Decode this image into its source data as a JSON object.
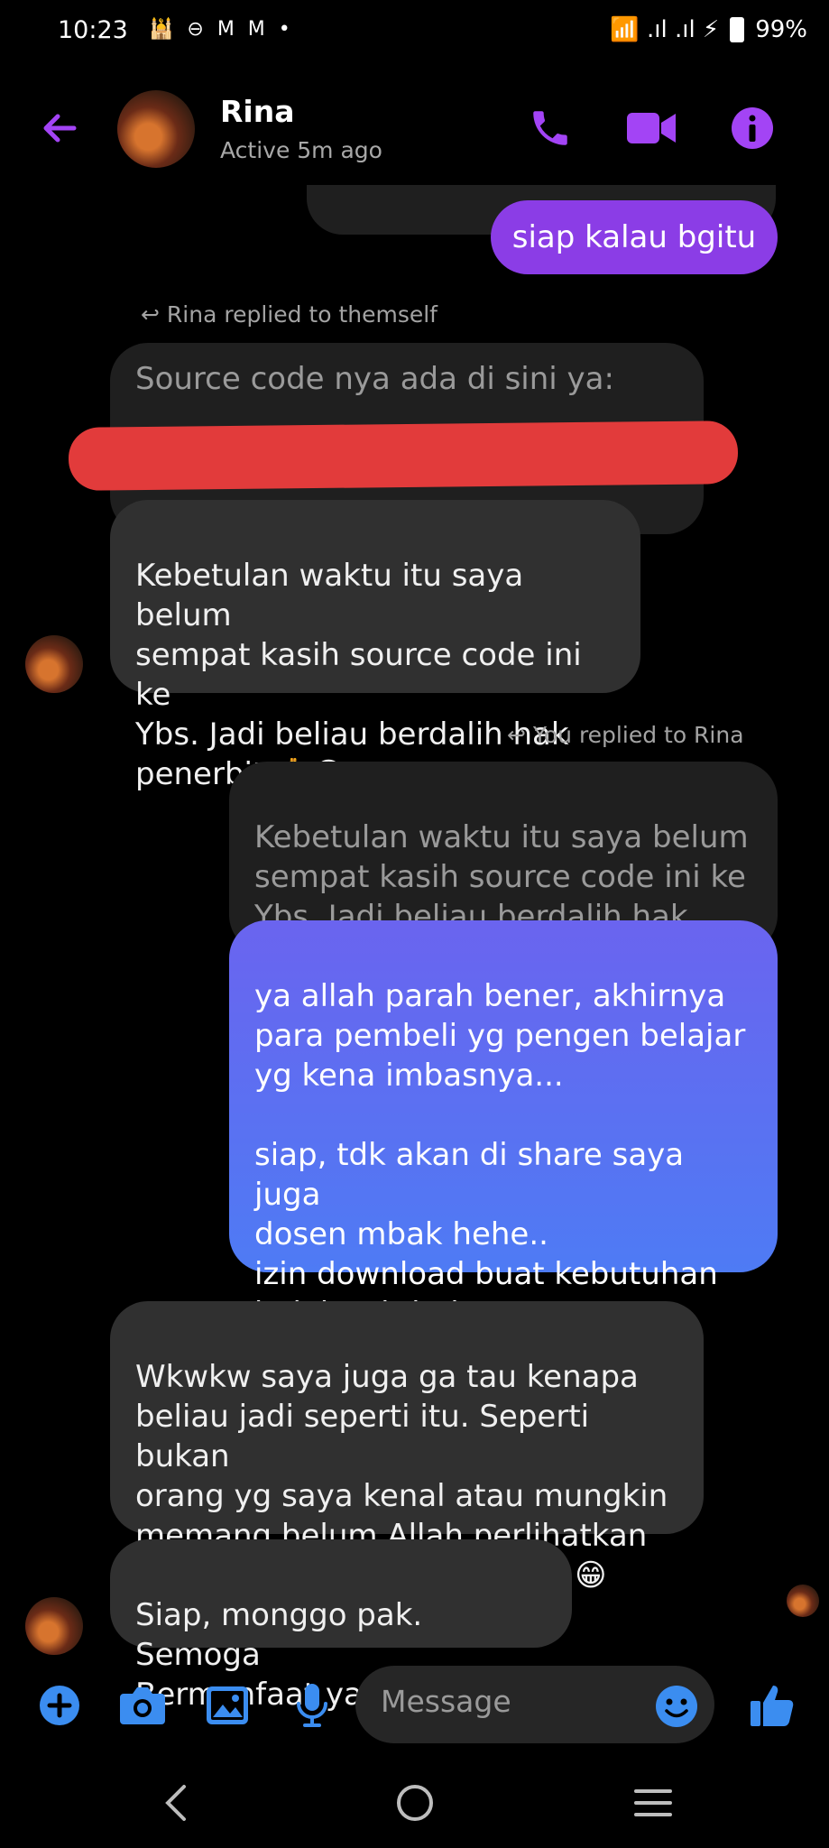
{
  "status_bar": {
    "time": "10:23",
    "left_icons": "🕌 ⊖ M M •",
    "right_icons": "📶 .ıl .ıl ⚡",
    "battery": "99%"
  },
  "header": {
    "name": "Rina",
    "status": "Active 5m ago",
    "icons": [
      "back-arrow-icon",
      "phone-icon",
      "video-icon",
      "info-icon"
    ],
    "accent_color": "#a344f5"
  },
  "messages": {
    "m1_out": "siap kalau bgitu",
    "note1": "Rina replied to themself",
    "m2_quoted": "Source code nya ada di sini ya:",
    "m3_in": "Kebetulan waktu itu saya belum\nsempat kasih source code ini ke\nYbs. Jadi beliau berdalih hak\npenerbit 🙏😁",
    "note2": "You replied to Rina",
    "m4_quoted": "Kebetulan waktu itu saya belum\nsempat kasih source code ini ke\nYbs. Jadi beliau berdalih hak pe...",
    "m5_out": "ya allah parah bener, akhirnya\npara pembeli yg pengen belajar\nyg kena imbasnya...\n\nsiap, tdk akan di share saya juga\ndosen mbak hehe..\nizin download buat kebutuhan\nbelajar dr bukunya ya...",
    "m6_in": "Wkwkw saya juga ga tau kenapa\nbeliau jadi seperti itu. Seperti bukan\norang yg saya kenal atau mungkin\nmemang belum Allah perlihatkan\nsosok aslinya saja waktu itu 😁",
    "m7_in": "Siap, monggo pak. Semoga\nBermanfaat yaa 🙏"
  },
  "composer": {
    "placeholder": "Message",
    "icons": [
      "plus-icon",
      "camera-icon",
      "gallery-icon",
      "mic-icon",
      "emoji-icon",
      "like-icon"
    ],
    "accent_color": "#3b8df0"
  },
  "nav": {
    "icons": [
      "nav-back-icon",
      "nav-home-icon",
      "nav-recents-icon"
    ]
  }
}
